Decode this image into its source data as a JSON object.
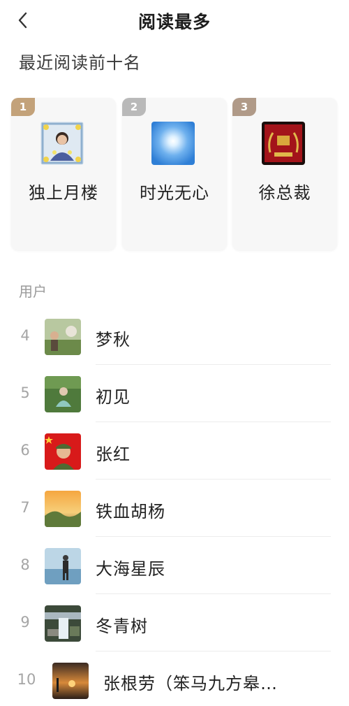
{
  "header": {
    "title": "阅读最多"
  },
  "section": {
    "title": "最近阅读前十名"
  },
  "top3": [
    {
      "rank": "1",
      "name": "独上月楼",
      "badge_color": "#c3a27a",
      "avatar": "woman-with-flowers-photo"
    },
    {
      "rank": "2",
      "name": "时光无心",
      "badge_color": "#b9b9b9",
      "avatar": "blue-sky-sun-photo"
    },
    {
      "rank": "3",
      "name": "徐总裁",
      "badge_color": "#b09a88",
      "avatar": "red-emblem-photo"
    }
  ],
  "users_label": "用户",
  "users": [
    {
      "rank": "4",
      "name": "梦秋",
      "avatar": "outdoor-people-photo"
    },
    {
      "rank": "5",
      "name": "初见",
      "avatar": "green-field-person-photo"
    },
    {
      "rank": "6",
      "name": "张红",
      "avatar": "red-background-soldier-photo"
    },
    {
      "rank": "7",
      "name": "铁血胡杨",
      "avatar": "desert-sunset-photo"
    },
    {
      "rank": "8",
      "name": "大海星辰",
      "avatar": "man-by-sea-photo"
    },
    {
      "rank": "9",
      "name": "冬青树",
      "avatar": "garden-waterfall-photo"
    },
    {
      "rank": "10",
      "name": "张根劳（笨马九方皋…",
      "avatar": "sunset-horse-photo"
    }
  ],
  "colors": {
    "accent_gold": "#c3a27a",
    "text_primary": "#222222",
    "text_secondary": "#9a9a9a",
    "card_bg": "#f7f7f7"
  }
}
